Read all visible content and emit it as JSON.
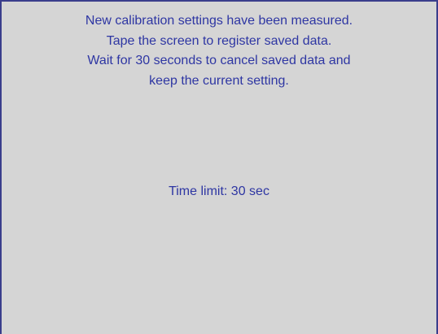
{
  "dialog": {
    "message_lines": [
      "New calibration settings have been measured.",
      "Tape the screen to register saved data.",
      "Wait for 30 seconds to cancel saved data and",
      "keep the current setting."
    ],
    "time_limit_text": "Time limit: 30 sec"
  },
  "colors": {
    "background": "#d5d5d5",
    "text": "#2e36a3",
    "border": "#3a3d8c"
  }
}
